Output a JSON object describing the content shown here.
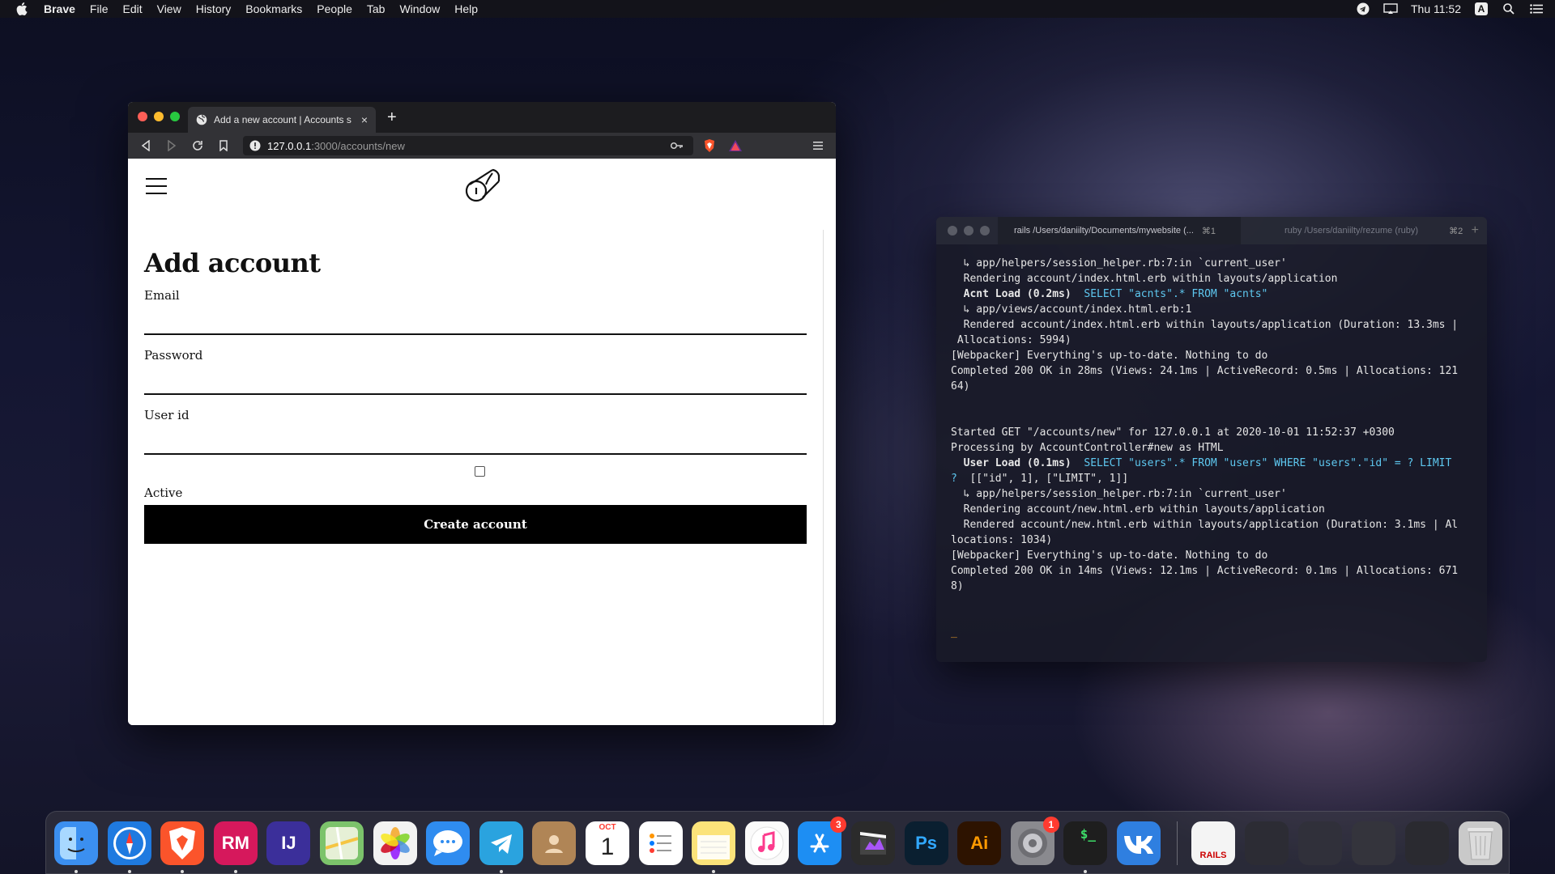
{
  "menubar": {
    "app_name": "Brave",
    "items": [
      "File",
      "Edit",
      "View",
      "History",
      "Bookmarks",
      "People",
      "Tab",
      "Window",
      "Help"
    ],
    "clock": "Thu 11:52",
    "input_source": "A"
  },
  "browser": {
    "tab_title": "Add a new account | Accounts s",
    "url_host": "127.0.0.1",
    "url_path": ":3000/accounts/new"
  },
  "page": {
    "heading": "Add account",
    "email_label": "Email",
    "password_label": "Password",
    "userid_label": "User id",
    "active_label": "Active",
    "submit_label": "Create account"
  },
  "terminal": {
    "tab_active": "rails /Users/daniilty/Documents/mywebsite (...",
    "tab_active_kbd": "⌘1",
    "tab_inactive": "ruby /Users/daniilty/rezume (ruby)",
    "tab_inactive_kbd": "⌘2",
    "lines": [
      {
        "pre": "  ↳ app/helpers/session_helper.rb:7:in `current_user'",
        "hl": "",
        "sql": ""
      },
      {
        "pre": "  Rendering account/index.html.erb within layouts/application",
        "hl": "",
        "sql": ""
      },
      {
        "pre": "  ",
        "hl": "Acnt Load (0.2ms)",
        "sql": "  SELECT \"acnts\".* FROM \"acnts\""
      },
      {
        "pre": "  ↳ app/views/account/index.html.erb:1",
        "hl": "",
        "sql": ""
      },
      {
        "pre": "  Rendered account/index.html.erb within layouts/application (Duration: 13.3ms |",
        "hl": "",
        "sql": ""
      },
      {
        "pre": " Allocations: 5994)",
        "hl": "",
        "sql": ""
      },
      {
        "pre": "[Webpacker] Everything's up-to-date. Nothing to do",
        "hl": "",
        "sql": ""
      },
      {
        "pre": "Completed 200 OK in 28ms (Views: 24.1ms | ActiveRecord: 0.5ms | Allocations: 121",
        "hl": "",
        "sql": ""
      },
      {
        "pre": "64)",
        "hl": "",
        "sql": ""
      },
      {
        "pre": "",
        "hl": "",
        "sql": ""
      },
      {
        "pre": "",
        "hl": "",
        "sql": ""
      },
      {
        "pre": "Started GET \"/accounts/new\" for 127.0.0.1 at 2020-10-01 11:52:37 +0300",
        "hl": "",
        "sql": ""
      },
      {
        "pre": "Processing by AccountController#new as HTML",
        "hl": "",
        "sql": ""
      },
      {
        "pre": "  ",
        "hl": "User Load (0.1ms)",
        "sql": "  SELECT \"users\".* FROM \"users\" WHERE \"users\".\"id\" = ? LIMIT"
      },
      {
        "pre": "",
        "hl": "",
        "sql": "?",
        "post": "  [[\"id\", 1], [\"LIMIT\", 1]]"
      },
      {
        "pre": "  ↳ app/helpers/session_helper.rb:7:in `current_user'",
        "hl": "",
        "sql": ""
      },
      {
        "pre": "  Rendering account/new.html.erb within layouts/application",
        "hl": "",
        "sql": ""
      },
      {
        "pre": "  Rendered account/new.html.erb within layouts/application (Duration: 3.1ms | Al",
        "hl": "",
        "sql": ""
      },
      {
        "pre": "locations: 1034)",
        "hl": "",
        "sql": ""
      },
      {
        "pre": "[Webpacker] Everything's up-to-date. Nothing to do",
        "hl": "",
        "sql": ""
      },
      {
        "pre": "Completed 200 OK in 14ms (Views: 12.1ms | ActiveRecord: 0.1ms | Allocations: 671",
        "hl": "",
        "sql": ""
      },
      {
        "pre": "8)",
        "hl": "",
        "sql": ""
      }
    ],
    "prompt_cursor": "_"
  },
  "dock": {
    "items": [
      {
        "name": "finder",
        "label": "",
        "bg": "#3b8ff0",
        "open": true
      },
      {
        "name": "safari",
        "label": "",
        "bg": "#1f7ae0",
        "open": true
      },
      {
        "name": "brave",
        "label": "",
        "bg": "#fb542b",
        "open": true
      },
      {
        "name": "rubymine",
        "label": "RM",
        "bg": "#d6185c",
        "open": true
      },
      {
        "name": "intellij",
        "label": "IJ",
        "bg": "#3b2f9a",
        "open": false
      },
      {
        "name": "maps",
        "label": "",
        "bg": "#7cc36b",
        "open": false
      },
      {
        "name": "photos",
        "label": "",
        "bg": "#f2f2f2",
        "open": false
      },
      {
        "name": "messages",
        "label": "",
        "bg": "#2f8cf0",
        "open": false
      },
      {
        "name": "telegram",
        "label": "",
        "bg": "#2aa3df",
        "open": true
      },
      {
        "name": "contacts",
        "label": "",
        "bg": "#b08556",
        "open": false
      },
      {
        "name": "calendar",
        "label": "1",
        "bg": "#ffffff",
        "open": false
      },
      {
        "name": "reminders",
        "label": "",
        "bg": "#ffffff",
        "open": false
      },
      {
        "name": "notes",
        "label": "",
        "bg": "#fbe37a",
        "open": true
      },
      {
        "name": "itunes",
        "label": "",
        "bg": "#fafafa",
        "open": false
      },
      {
        "name": "app-store",
        "label": "",
        "bg": "#1d8ef3",
        "open": false,
        "badge": "3"
      },
      {
        "name": "final-cut",
        "label": "",
        "bg": "#2b2b2b",
        "open": false
      },
      {
        "name": "photoshop",
        "label": "Ps",
        "bg": "#0a1f30",
        "open": false
      },
      {
        "name": "illustrator",
        "label": "Ai",
        "bg": "#2d1300",
        "open": false
      },
      {
        "name": "system-preferences",
        "label": "",
        "bg": "#8a8a8f",
        "open": false,
        "badge": "1"
      },
      {
        "name": "terminal-app",
        "label": "$_",
        "bg": "#1e1e1e",
        "open": true
      },
      {
        "name": "vk",
        "label": "",
        "bg": "#2f7fe0",
        "open": false
      }
    ],
    "right_items": [
      {
        "name": "rails-doc",
        "label": "RAILS",
        "bg": "#f4f4f4"
      },
      {
        "name": "window-thumb-1",
        "label": "",
        "bg": "#2c2c34"
      },
      {
        "name": "window-thumb-2",
        "label": "",
        "bg": "#30303a"
      },
      {
        "name": "window-thumb-3",
        "label": "",
        "bg": "#34343c"
      },
      {
        "name": "window-thumb-4",
        "label": "",
        "bg": "#2a2a30"
      },
      {
        "name": "trash",
        "label": "",
        "bg": "#c9c9c9"
      }
    ],
    "calendar_month": "OCT"
  }
}
